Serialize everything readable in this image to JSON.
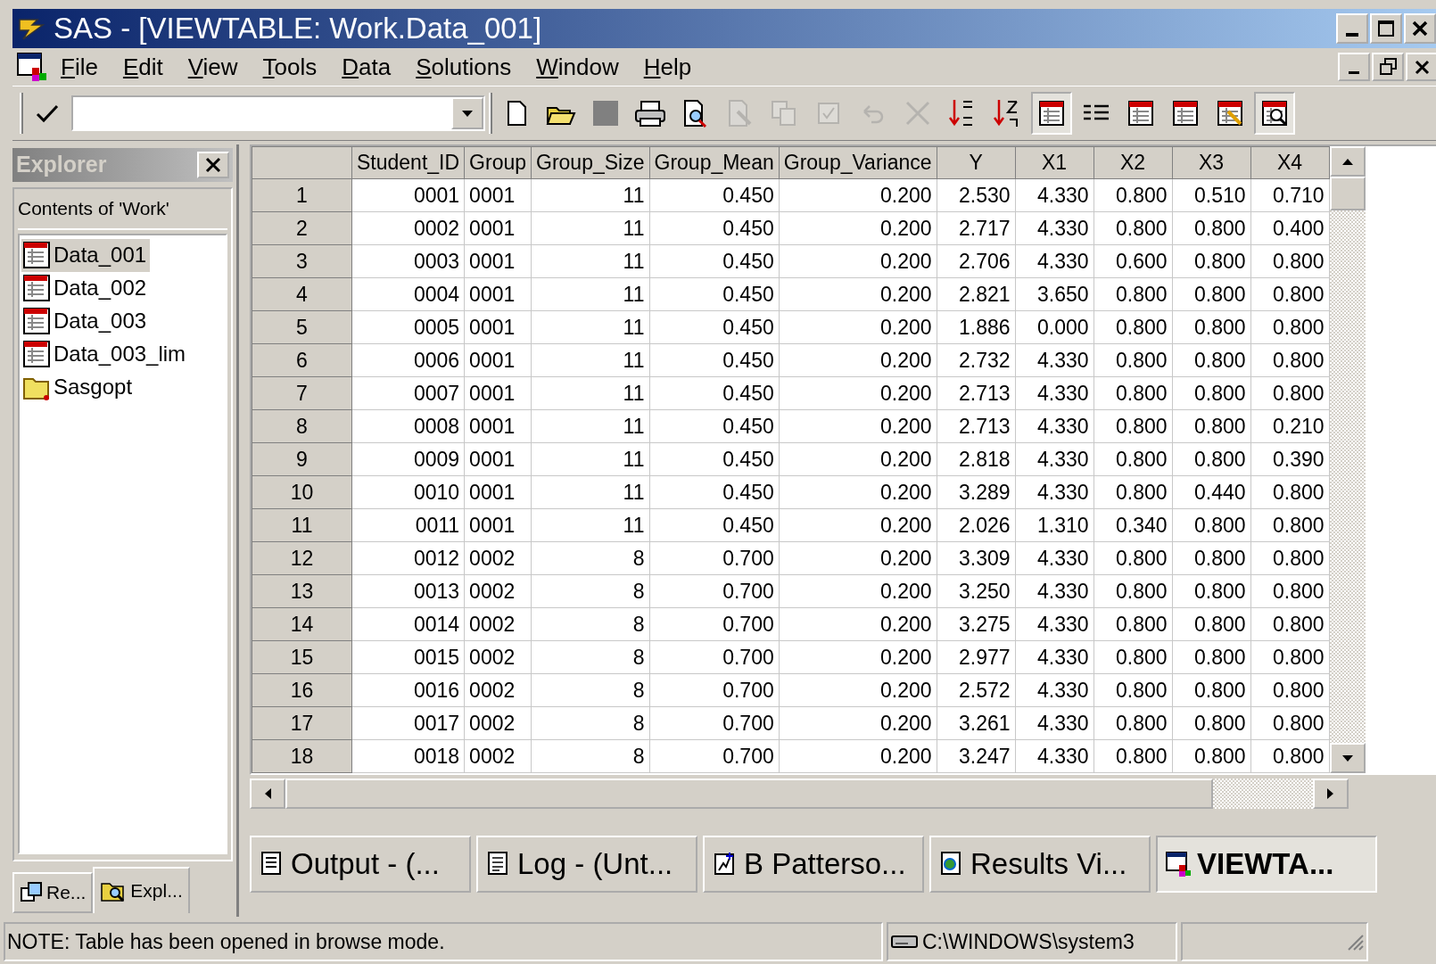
{
  "window": {
    "title": "SAS - [VIEWTABLE: Work.Data_001]"
  },
  "menu": [
    "File",
    "Edit",
    "View",
    "Tools",
    "Data",
    "Solutions",
    "Window",
    "Help"
  ],
  "toolbar": [
    {
      "kind": "new",
      "disabled": false,
      "pressed": false
    },
    {
      "kind": "open",
      "disabled": false,
      "pressed": false
    },
    {
      "kind": "stop",
      "disabled": false,
      "pressed": false
    },
    {
      "kind": "print",
      "disabled": false,
      "pressed": false
    },
    {
      "kind": "preview",
      "disabled": false,
      "pressed": false
    },
    {
      "kind": "edit",
      "disabled": true,
      "pressed": false
    },
    {
      "kind": "copy",
      "disabled": true,
      "pressed": false
    },
    {
      "kind": "check",
      "disabled": true,
      "pressed": false
    },
    {
      "kind": "undo",
      "disabled": true,
      "pressed": false
    },
    {
      "kind": "delete",
      "disabled": true,
      "pressed": false
    },
    {
      "kind": "sortup",
      "disabled": false,
      "pressed": false
    },
    {
      "kind": "sortdown",
      "disabled": false,
      "pressed": false
    },
    {
      "kind": "table",
      "disabled": false,
      "pressed": true
    },
    {
      "kind": "list",
      "disabled": false,
      "pressed": false
    },
    {
      "kind": "table",
      "disabled": false,
      "pressed": false
    },
    {
      "kind": "table",
      "disabled": false,
      "pressed": false
    },
    {
      "kind": "tableedit",
      "disabled": false,
      "pressed": false
    },
    {
      "kind": "tablezoom",
      "disabled": false,
      "pressed": true
    }
  ],
  "explorer": {
    "title": "Explorer",
    "heading": "Contents of 'Work'",
    "items": [
      {
        "label": "Data_001",
        "kind": "table",
        "selected": true
      },
      {
        "label": "Data_002",
        "kind": "table",
        "selected": false
      },
      {
        "label": "Data_003",
        "kind": "table",
        "selected": false
      },
      {
        "label": "Data_003_lim",
        "kind": "table",
        "selected": false
      },
      {
        "label": "Sasgopt",
        "kind": "library",
        "selected": false
      }
    ],
    "tabs": [
      {
        "label": "Re...",
        "kind": "results",
        "selected": false
      },
      {
        "label": "Expl...",
        "kind": "explorer",
        "selected": true
      }
    ]
  },
  "table": {
    "columns": [
      "",
      "Student_ID",
      "Group",
      "Group_Size",
      "Group_Mean",
      "Group_Variance",
      "Y",
      "X1",
      "X2",
      "X3",
      "X4"
    ],
    "rows": [
      [
        "1",
        "0001",
        "0001",
        "11",
        "0.450",
        "0.200",
        "2.530",
        "4.330",
        "0.800",
        "0.510",
        "0.710"
      ],
      [
        "2",
        "0002",
        "0001",
        "11",
        "0.450",
        "0.200",
        "2.717",
        "4.330",
        "0.800",
        "0.800",
        "0.400"
      ],
      [
        "3",
        "0003",
        "0001",
        "11",
        "0.450",
        "0.200",
        "2.706",
        "4.330",
        "0.600",
        "0.800",
        "0.800"
      ],
      [
        "4",
        "0004",
        "0001",
        "11",
        "0.450",
        "0.200",
        "2.821",
        "3.650",
        "0.800",
        "0.800",
        "0.800"
      ],
      [
        "5",
        "0005",
        "0001",
        "11",
        "0.450",
        "0.200",
        "1.886",
        "0.000",
        "0.800",
        "0.800",
        "0.800"
      ],
      [
        "6",
        "0006",
        "0001",
        "11",
        "0.450",
        "0.200",
        "2.732",
        "4.330",
        "0.800",
        "0.800",
        "0.800"
      ],
      [
        "7",
        "0007",
        "0001",
        "11",
        "0.450",
        "0.200",
        "2.713",
        "4.330",
        "0.800",
        "0.800",
        "0.800"
      ],
      [
        "8",
        "0008",
        "0001",
        "11",
        "0.450",
        "0.200",
        "2.713",
        "4.330",
        "0.800",
        "0.800",
        "0.210"
      ],
      [
        "9",
        "0009",
        "0001",
        "11",
        "0.450",
        "0.200",
        "2.818",
        "4.330",
        "0.800",
        "0.800",
        "0.390"
      ],
      [
        "10",
        "0010",
        "0001",
        "11",
        "0.450",
        "0.200",
        "3.289",
        "4.330",
        "0.800",
        "0.440",
        "0.800"
      ],
      [
        "11",
        "0011",
        "0001",
        "11",
        "0.450",
        "0.200",
        "2.026",
        "1.310",
        "0.340",
        "0.800",
        "0.800"
      ],
      [
        "12",
        "0012",
        "0002",
        "8",
        "0.700",
        "0.200",
        "3.309",
        "4.330",
        "0.800",
        "0.800",
        "0.800"
      ],
      [
        "13",
        "0013",
        "0002",
        "8",
        "0.700",
        "0.200",
        "3.250",
        "4.330",
        "0.800",
        "0.800",
        "0.800"
      ],
      [
        "14",
        "0014",
        "0002",
        "8",
        "0.700",
        "0.200",
        "3.275",
        "4.330",
        "0.800",
        "0.800",
        "0.800"
      ],
      [
        "15",
        "0015",
        "0002",
        "8",
        "0.700",
        "0.200",
        "2.977",
        "4.330",
        "0.800",
        "0.800",
        "0.800"
      ],
      [
        "16",
        "0016",
        "0002",
        "8",
        "0.700",
        "0.200",
        "2.572",
        "4.330",
        "0.800",
        "0.800",
        "0.800"
      ],
      [
        "17",
        "0017",
        "0002",
        "8",
        "0.700",
        "0.200",
        "3.261",
        "4.330",
        "0.800",
        "0.800",
        "0.800"
      ],
      [
        "18",
        "0018",
        "0002",
        "8",
        "0.700",
        "0.200",
        "3.247",
        "4.330",
        "0.800",
        "0.800",
        "0.800"
      ]
    ]
  },
  "window_tabs": [
    {
      "label": "Output - (...",
      "kind": "output",
      "selected": false
    },
    {
      "label": "Log - (Unt...",
      "kind": "log",
      "selected": false
    },
    {
      "label": "B Patterso...",
      "kind": "program",
      "selected": false
    },
    {
      "label": "Results Vi...",
      "kind": "results",
      "selected": false
    },
    {
      "label": "VIEWTA...",
      "kind": "viewtable",
      "selected": true
    }
  ],
  "status_bar": {
    "message": "NOTE: Table has been opened in browse mode.",
    "path": "C:\\WINDOWS\\system3"
  }
}
